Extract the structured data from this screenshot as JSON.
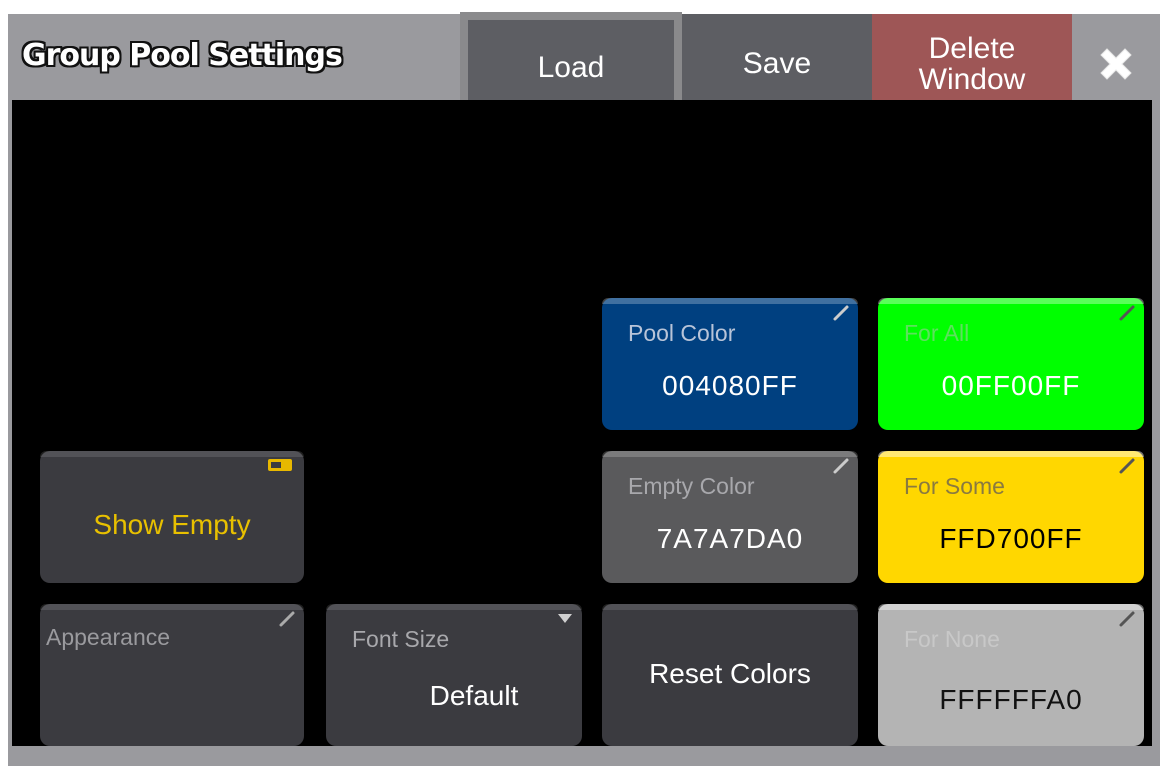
{
  "window": {
    "title": "Group Pool Settings",
    "load_label": "Load",
    "save_label": "Save",
    "delete_label_line1": "Delete",
    "delete_label_line2": "Window",
    "close_icon": "close-icon"
  },
  "controls": {
    "show_empty": {
      "label": "Show Empty",
      "state_icon": "toggle-indicator-icon"
    },
    "appearance": {
      "label": "Appearance",
      "value": ""
    },
    "font_size": {
      "label": "Font Size",
      "value": "Default"
    },
    "reset_colors": {
      "label": "Reset Colors"
    },
    "pool_color": {
      "label": "Pool Color",
      "value": "004080FF",
      "color": "#004080"
    },
    "empty_color": {
      "label": "Empty Color",
      "value": "7A7A7DA0",
      "color": "#5a5a5c"
    },
    "for_all": {
      "label": "For All",
      "value": "00FF00FF",
      "color": "#00ff00"
    },
    "for_some": {
      "label": "For Some",
      "value": "FFD700FF",
      "color": "#ffd700"
    },
    "for_none": {
      "label": "For None",
      "value": "FFFFFFA0",
      "color": "#b4b4b4"
    }
  }
}
